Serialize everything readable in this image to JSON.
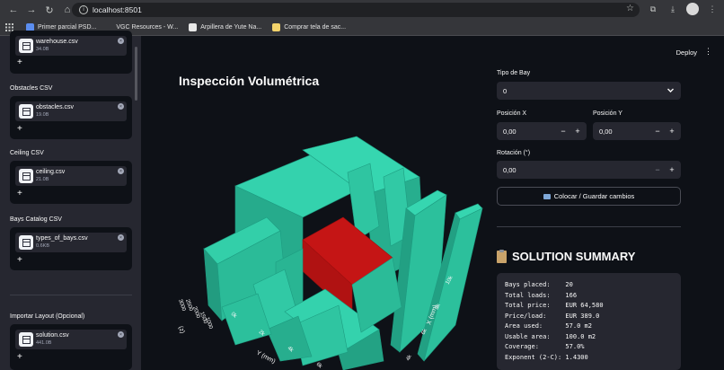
{
  "browser": {
    "url": "localhost:8501",
    "bookmarks": [
      {
        "label": "Primer parcial PSD..."
      },
      {
        "label": "VGC Resources - W..."
      },
      {
        "label": "Arpillera de Yute Na..."
      },
      {
        "label": "Comprar tela de sac..."
      }
    ]
  },
  "sidebar": {
    "uploaders": [
      {
        "label": "",
        "file": "warehouse.csv",
        "size": "34.0B"
      },
      {
        "label": "Obstacles CSV",
        "file": "obstacles.csv",
        "size": "19.0B"
      },
      {
        "label": "Ceiling CSV",
        "file": "ceiling.csv",
        "size": "21.0B"
      },
      {
        "label": "Bays Catalog CSV",
        "file": "types_of_bays.csv",
        "size": "0.6KB"
      },
      {
        "label": "Importar Layout (Opcional)",
        "file": "solution.csv",
        "size": "441.0B"
      }
    ],
    "add_glyph": "+",
    "remove_glyph": "×"
  },
  "header": {
    "deploy": "Deploy",
    "menu_glyph": "⋮"
  },
  "main": {
    "title": "Inspección Volumétrica",
    "plot": {
      "x_axis_label": "X (mm)",
      "y_axis_label": "Y (mm)",
      "z_axis_label": "(z)",
      "x_ticks": [
        "10k",
        "8k",
        "6k",
        "4k",
        "2k"
      ],
      "y_ticks": [
        "0k",
        "2k",
        "4k",
        "6k",
        "8k"
      ],
      "z_ticks": [
        "0",
        "500",
        "1000",
        "1500",
        "2000",
        "2500",
        "3000"
      ],
      "colors": {
        "bays": "#2fbf9f",
        "highlight": "#c51515",
        "background": "#0e1117"
      }
    }
  },
  "controls": {
    "tipo_bay_label": "Tipo de Bay",
    "tipo_bay_value": "0",
    "pos_x_label": "Posición X",
    "pos_x_value": "0,00",
    "pos_y_label": "Posición Y",
    "pos_y_value": "0,00",
    "rot_label": "Rotación (°)",
    "rot_value": "0,00",
    "minus": "−",
    "plus": "+",
    "save_button": "Colocar / Guardar cambios"
  },
  "summary": {
    "title": "SOLUTION SUMMARY",
    "lines": [
      "Bays placed:    20",
      "Total loads:    166",
      "Total price:    EUR 64,580",
      "Price/load:     EUR 389.0",
      "Area used:      57.0 m2",
      "Usable area:    100.0 m2",
      "Coverage:       57.0%",
      "Exponent (2-C): 1.4300"
    ]
  }
}
